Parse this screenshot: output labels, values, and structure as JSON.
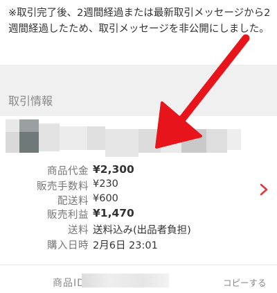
{
  "notice": {
    "text": "※取引完了後、2週間経過または最新取引メッセージから2週間経過したため、取引メッセージを非公開にしました。"
  },
  "transaction_info": {
    "title": "取引情報"
  },
  "details": [
    {
      "label": "商品代金",
      "value": "¥2,300",
      "bold": true
    },
    {
      "label": "販売手数料",
      "value": "¥230",
      "bold": false
    },
    {
      "label": "配送料",
      "value": "¥600",
      "bold": false
    },
    {
      "label": "販売利益",
      "value": "¥1,470",
      "bold": true
    },
    {
      "label": "送料",
      "value": "送料込み(出品者負担)",
      "bold": false
    },
    {
      "label": "購入日時",
      "value": "2月6日 23:01",
      "bold": false
    }
  ],
  "footer": {
    "item_id_label": "商品ID",
    "copy_label": "コピーする"
  },
  "colors": {
    "arrow": "#e8141c",
    "chevron": "#e0363b",
    "section_bg": "#f0f0f0"
  },
  "icons": {
    "chevron": "chevron-right-icon",
    "annotation": "red-arrow-annotation"
  }
}
